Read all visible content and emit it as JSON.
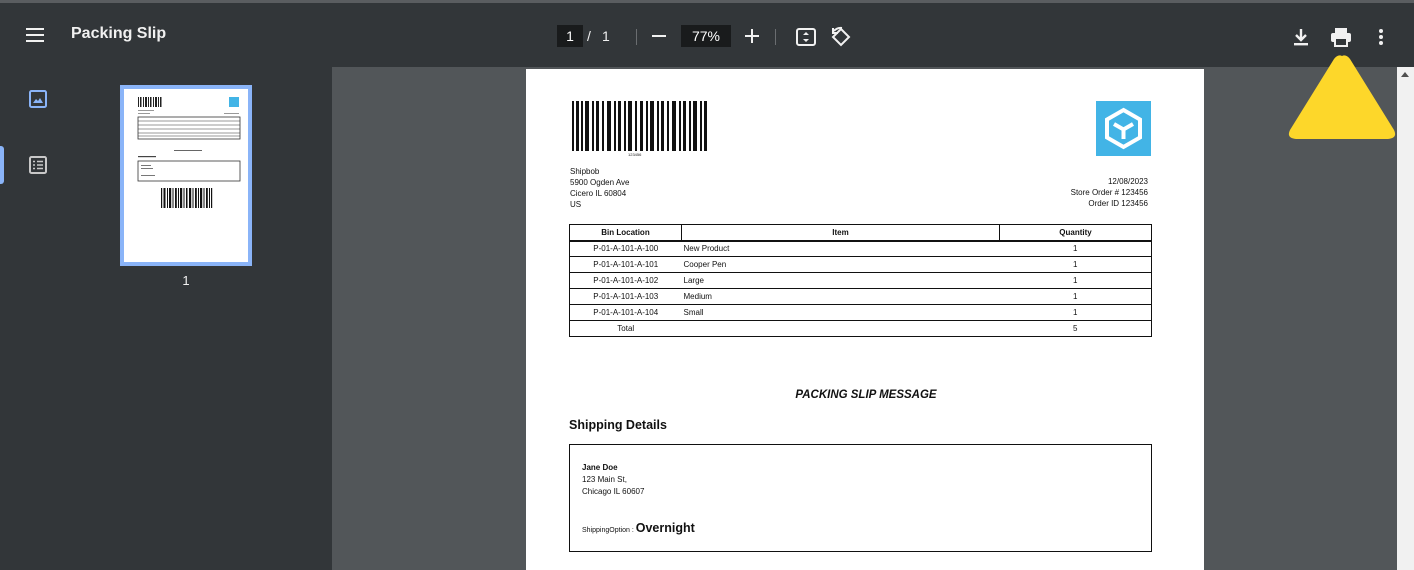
{
  "toolbar": {
    "title": "Packing Slip",
    "current_page": "1",
    "page_separator": "/",
    "total_pages": "1",
    "zoom": "77%"
  },
  "sidebar": {
    "thumbnail_page_number": "1"
  },
  "document": {
    "barcode_number": "123456",
    "sender": {
      "name": "Shipbob",
      "street": "5900 Ogden Ave",
      "city": "Cicero IL 60804",
      "country": "US"
    },
    "order_info": {
      "date": "12/08/2023",
      "store_order": "Store Order # 123456",
      "order_id": "Order ID 123456"
    },
    "table": {
      "headers": [
        "Bin Location",
        "Item",
        "Quantity"
      ],
      "rows": [
        {
          "bin": "P-01-A-101-A-100",
          "item": "New Product",
          "qty": "1"
        },
        {
          "bin": "P-01-A-101-A-101",
          "item": "Cooper Pen",
          "qty": "1"
        },
        {
          "bin": "P-01-A-101-A-102",
          "item": "Large",
          "qty": "1"
        },
        {
          "bin": "P-01-A-101-A-103",
          "item": "Medium",
          "qty": "1"
        },
        {
          "bin": "P-01-A-101-A-104",
          "item": "Small",
          "qty": "1"
        }
      ],
      "total_label": "Total",
      "total_qty": "5"
    },
    "message": "PACKING SLIP MESSAGE",
    "shipping": {
      "heading": "Shipping Details",
      "name": "Jane Doe",
      "street": "123 Main St,",
      "city": "Chicago IL 60607",
      "option_label": "ShippingOption :",
      "option_value": "Overnight"
    }
  },
  "colors": {
    "toolbar_bg": "#323639",
    "viewer_bg": "#525659",
    "accent": "#8ab4f8",
    "logo": "#42b4e6",
    "annotation": "#fdd72a"
  },
  "icons": [
    "menu-icon",
    "fit-page-icon",
    "rotate-icon",
    "download-icon",
    "print-icon",
    "more-vert-icon",
    "thumbnails-icon",
    "outline-icon"
  ]
}
